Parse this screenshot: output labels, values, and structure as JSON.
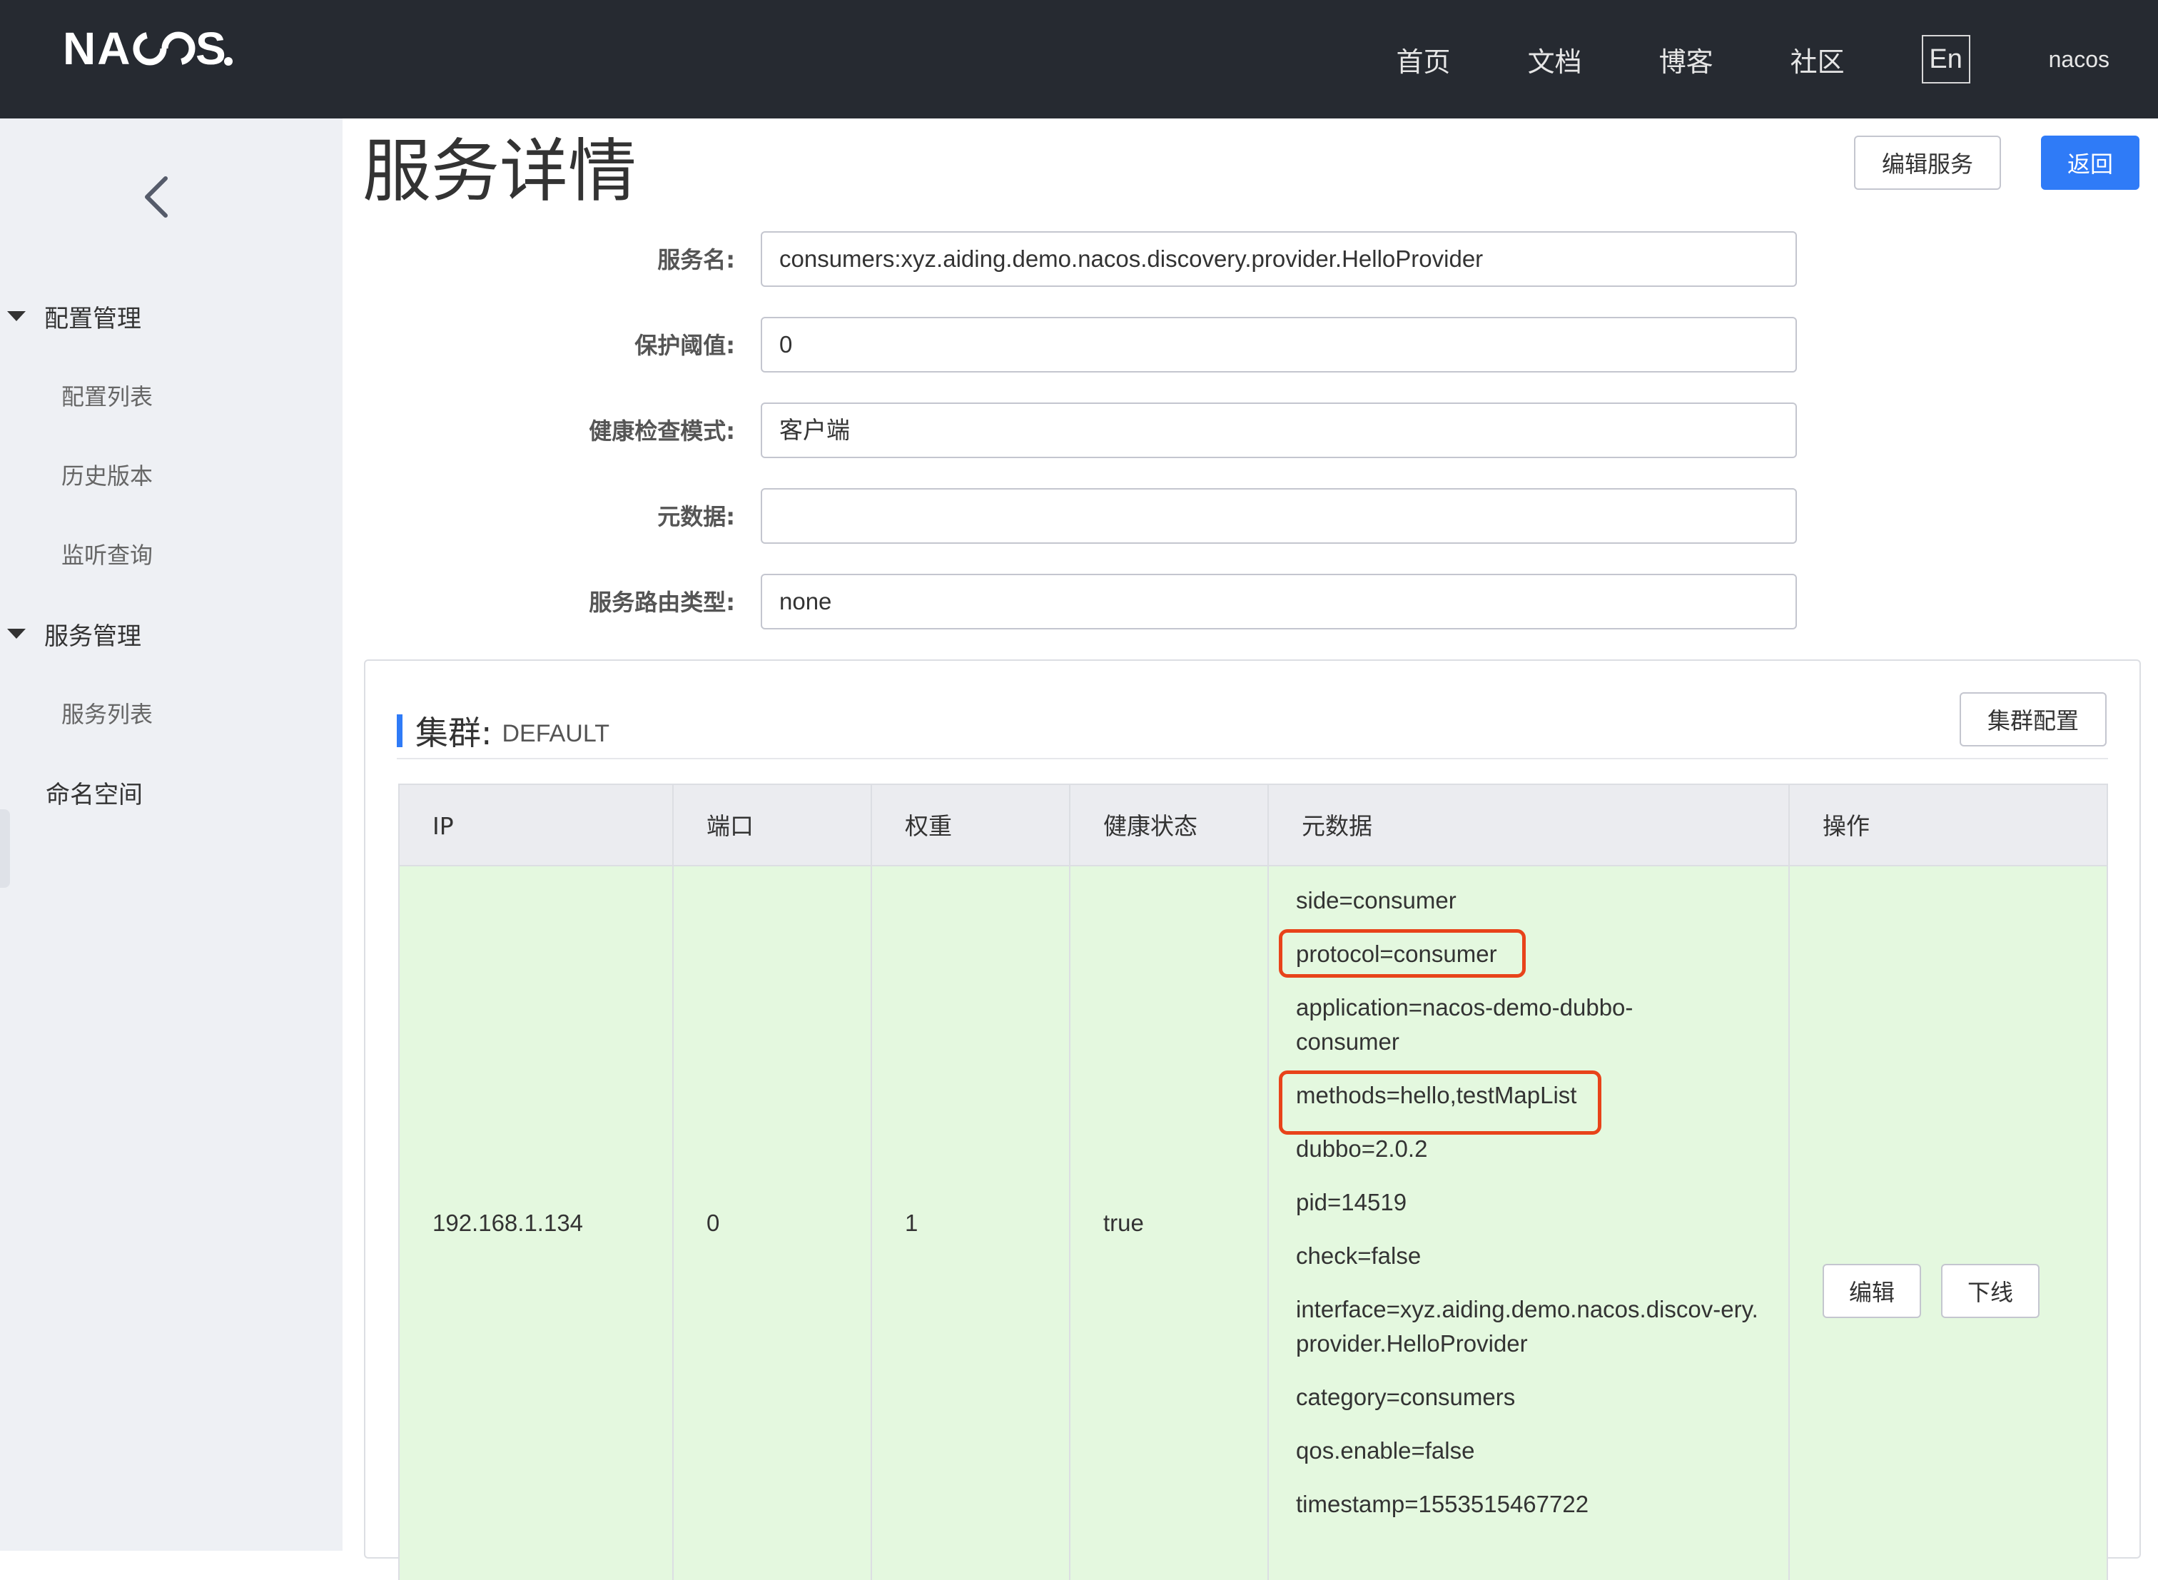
{
  "header": {
    "logo": "NACOS.",
    "nav": [
      "首页",
      "文档",
      "博客",
      "社区"
    ],
    "lang": "En",
    "user": "nacos"
  },
  "sidebar": {
    "groups": [
      {
        "label": "配置管理",
        "items": [
          "配置列表",
          "历史版本",
          "监听查询"
        ]
      },
      {
        "label": "服务管理",
        "items": [
          "服务列表"
        ]
      }
    ],
    "plain_item": "命名空间"
  },
  "page": {
    "title": "服务详情",
    "edit_service_label": "编辑服务",
    "back_label": "返回"
  },
  "form": [
    {
      "label": "服务名:",
      "value": "consumers:xyz.aiding.demo.nacos.discovery.provider.HelloProvider"
    },
    {
      "label": "保护阈值:",
      "value": "0"
    },
    {
      "label": "健康检查模式:",
      "value": "客户端"
    },
    {
      "label": "元数据:",
      "value": ""
    },
    {
      "label": "服务路由类型:",
      "value": "none"
    }
  ],
  "cluster": {
    "title": "集群:",
    "name": "DEFAULT",
    "config_button": "集群配置",
    "columns": [
      "IP",
      "端口",
      "权重",
      "健康状态",
      "元数据",
      "操作"
    ],
    "rows": [
      {
        "ip": "192.168.1.134",
        "port": "0",
        "weight": "1",
        "healthy": "true",
        "metadata": [
          "side=consumer",
          "protocol=consumer",
          "application=nacos-demo-dubbo-consumer",
          "methods=hello,testMapList",
          "dubbo=2.0.2",
          "pid=14519",
          "check=false",
          "interface=xyz.aiding.demo.nacos.discov-ery.provider.HelloProvider",
          "category=consumers",
          "qos.enable=false",
          "timestamp=1553515467722"
        ],
        "actions": [
          "编辑",
          "下线"
        ]
      }
    ]
  },
  "colors": {
    "header_bg": "#262a31",
    "sidebar_bg": "#eef0f4",
    "primary": "#2f7bf7",
    "healthy_row_bg": "#e4f8df",
    "highlight": "#e8431a"
  }
}
